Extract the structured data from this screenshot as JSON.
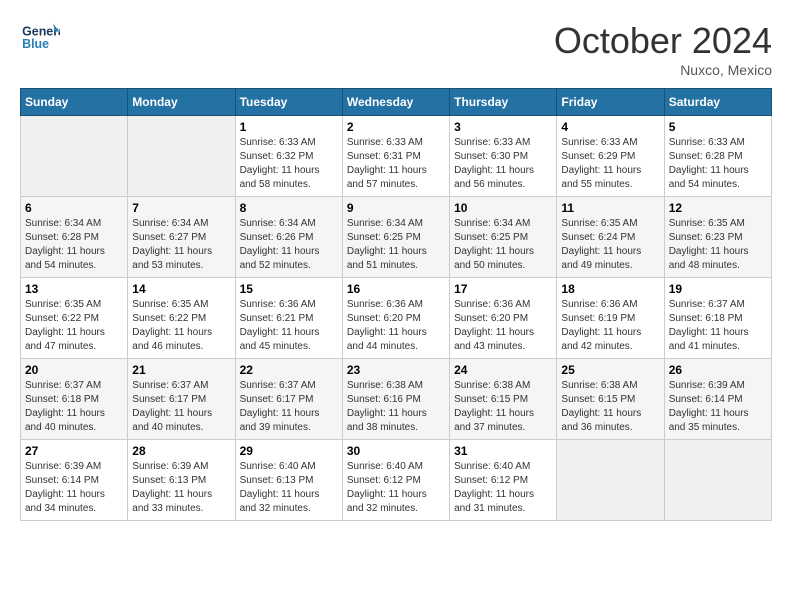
{
  "header": {
    "logo_general": "General",
    "logo_blue": "Blue",
    "month_title": "October 2024",
    "location": "Nuxco, Mexico"
  },
  "weekdays": [
    "Sunday",
    "Monday",
    "Tuesday",
    "Wednesday",
    "Thursday",
    "Friday",
    "Saturday"
  ],
  "weeks": [
    [
      {
        "day": null
      },
      {
        "day": null
      },
      {
        "day": "1",
        "sunrise": "Sunrise: 6:33 AM",
        "sunset": "Sunset: 6:32 PM",
        "daylight": "Daylight: 11 hours and 58 minutes."
      },
      {
        "day": "2",
        "sunrise": "Sunrise: 6:33 AM",
        "sunset": "Sunset: 6:31 PM",
        "daylight": "Daylight: 11 hours and 57 minutes."
      },
      {
        "day": "3",
        "sunrise": "Sunrise: 6:33 AM",
        "sunset": "Sunset: 6:30 PM",
        "daylight": "Daylight: 11 hours and 56 minutes."
      },
      {
        "day": "4",
        "sunrise": "Sunrise: 6:33 AM",
        "sunset": "Sunset: 6:29 PM",
        "daylight": "Daylight: 11 hours and 55 minutes."
      },
      {
        "day": "5",
        "sunrise": "Sunrise: 6:33 AM",
        "sunset": "Sunset: 6:28 PM",
        "daylight": "Daylight: 11 hours and 54 minutes."
      }
    ],
    [
      {
        "day": "6",
        "sunrise": "Sunrise: 6:34 AM",
        "sunset": "Sunset: 6:28 PM",
        "daylight": "Daylight: 11 hours and 54 minutes."
      },
      {
        "day": "7",
        "sunrise": "Sunrise: 6:34 AM",
        "sunset": "Sunset: 6:27 PM",
        "daylight": "Daylight: 11 hours and 53 minutes."
      },
      {
        "day": "8",
        "sunrise": "Sunrise: 6:34 AM",
        "sunset": "Sunset: 6:26 PM",
        "daylight": "Daylight: 11 hours and 52 minutes."
      },
      {
        "day": "9",
        "sunrise": "Sunrise: 6:34 AM",
        "sunset": "Sunset: 6:25 PM",
        "daylight": "Daylight: 11 hours and 51 minutes."
      },
      {
        "day": "10",
        "sunrise": "Sunrise: 6:34 AM",
        "sunset": "Sunset: 6:25 PM",
        "daylight": "Daylight: 11 hours and 50 minutes."
      },
      {
        "day": "11",
        "sunrise": "Sunrise: 6:35 AM",
        "sunset": "Sunset: 6:24 PM",
        "daylight": "Daylight: 11 hours and 49 minutes."
      },
      {
        "day": "12",
        "sunrise": "Sunrise: 6:35 AM",
        "sunset": "Sunset: 6:23 PM",
        "daylight": "Daylight: 11 hours and 48 minutes."
      }
    ],
    [
      {
        "day": "13",
        "sunrise": "Sunrise: 6:35 AM",
        "sunset": "Sunset: 6:22 PM",
        "daylight": "Daylight: 11 hours and 47 minutes."
      },
      {
        "day": "14",
        "sunrise": "Sunrise: 6:35 AM",
        "sunset": "Sunset: 6:22 PM",
        "daylight": "Daylight: 11 hours and 46 minutes."
      },
      {
        "day": "15",
        "sunrise": "Sunrise: 6:36 AM",
        "sunset": "Sunset: 6:21 PM",
        "daylight": "Daylight: 11 hours and 45 minutes."
      },
      {
        "day": "16",
        "sunrise": "Sunrise: 6:36 AM",
        "sunset": "Sunset: 6:20 PM",
        "daylight": "Daylight: 11 hours and 44 minutes."
      },
      {
        "day": "17",
        "sunrise": "Sunrise: 6:36 AM",
        "sunset": "Sunset: 6:20 PM",
        "daylight": "Daylight: 11 hours and 43 minutes."
      },
      {
        "day": "18",
        "sunrise": "Sunrise: 6:36 AM",
        "sunset": "Sunset: 6:19 PM",
        "daylight": "Daylight: 11 hours and 42 minutes."
      },
      {
        "day": "19",
        "sunrise": "Sunrise: 6:37 AM",
        "sunset": "Sunset: 6:18 PM",
        "daylight": "Daylight: 11 hours and 41 minutes."
      }
    ],
    [
      {
        "day": "20",
        "sunrise": "Sunrise: 6:37 AM",
        "sunset": "Sunset: 6:18 PM",
        "daylight": "Daylight: 11 hours and 40 minutes."
      },
      {
        "day": "21",
        "sunrise": "Sunrise: 6:37 AM",
        "sunset": "Sunset: 6:17 PM",
        "daylight": "Daylight: 11 hours and 40 minutes."
      },
      {
        "day": "22",
        "sunrise": "Sunrise: 6:37 AM",
        "sunset": "Sunset: 6:17 PM",
        "daylight": "Daylight: 11 hours and 39 minutes."
      },
      {
        "day": "23",
        "sunrise": "Sunrise: 6:38 AM",
        "sunset": "Sunset: 6:16 PM",
        "daylight": "Daylight: 11 hours and 38 minutes."
      },
      {
        "day": "24",
        "sunrise": "Sunrise: 6:38 AM",
        "sunset": "Sunset: 6:15 PM",
        "daylight": "Daylight: 11 hours and 37 minutes."
      },
      {
        "day": "25",
        "sunrise": "Sunrise: 6:38 AM",
        "sunset": "Sunset: 6:15 PM",
        "daylight": "Daylight: 11 hours and 36 minutes."
      },
      {
        "day": "26",
        "sunrise": "Sunrise: 6:39 AM",
        "sunset": "Sunset: 6:14 PM",
        "daylight": "Daylight: 11 hours and 35 minutes."
      }
    ],
    [
      {
        "day": "27",
        "sunrise": "Sunrise: 6:39 AM",
        "sunset": "Sunset: 6:14 PM",
        "daylight": "Daylight: 11 hours and 34 minutes."
      },
      {
        "day": "28",
        "sunrise": "Sunrise: 6:39 AM",
        "sunset": "Sunset: 6:13 PM",
        "daylight": "Daylight: 11 hours and 33 minutes."
      },
      {
        "day": "29",
        "sunrise": "Sunrise: 6:40 AM",
        "sunset": "Sunset: 6:13 PM",
        "daylight": "Daylight: 11 hours and 32 minutes."
      },
      {
        "day": "30",
        "sunrise": "Sunrise: 6:40 AM",
        "sunset": "Sunset: 6:12 PM",
        "daylight": "Daylight: 11 hours and 32 minutes."
      },
      {
        "day": "31",
        "sunrise": "Sunrise: 6:40 AM",
        "sunset": "Sunset: 6:12 PM",
        "daylight": "Daylight: 11 hours and 31 minutes."
      },
      {
        "day": null
      },
      {
        "day": null
      }
    ]
  ]
}
